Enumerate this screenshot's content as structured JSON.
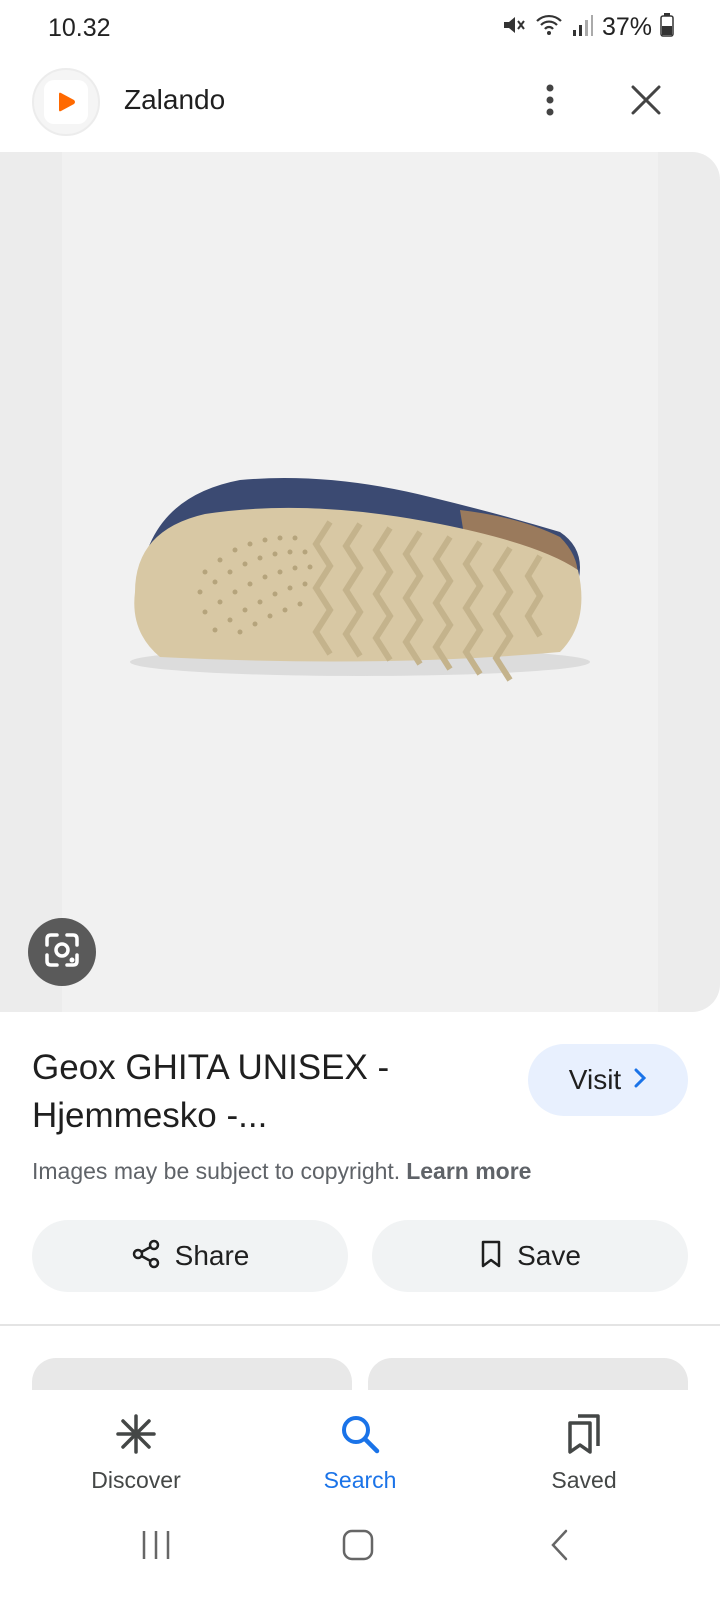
{
  "status_bar": {
    "time": "10.32",
    "battery": "37%",
    "icons": [
      "mute-icon",
      "wifi-icon",
      "signal-icon",
      "battery-icon"
    ]
  },
  "header": {
    "site_name": "Zalando",
    "logo_icon": "zalando-play-icon",
    "logo_color": "#ff6900",
    "more_icon": "more-vert-icon",
    "close_icon": "close-icon"
  },
  "image": {
    "lens_icon": "google-lens-icon"
  },
  "product": {
    "title": "Geox GHITA UNISEX - Hjemmesko -...",
    "visit_label": "Visit",
    "copyright_text": "Images may be subject to copyright.",
    "learn_more": "Learn more"
  },
  "actions": {
    "share_label": "Share",
    "save_label": "Save"
  },
  "bottom_nav": {
    "items": [
      {
        "label": "Discover",
        "icon": "asterisk-icon",
        "active": false
      },
      {
        "label": "Search",
        "icon": "search-icon",
        "active": true
      },
      {
        "label": "Saved",
        "icon": "saved-collections-icon",
        "active": false
      }
    ],
    "accent_color": "#1a73e8"
  },
  "system_nav": {
    "icons": [
      "recents-icon",
      "home-icon",
      "back-icon"
    ]
  }
}
